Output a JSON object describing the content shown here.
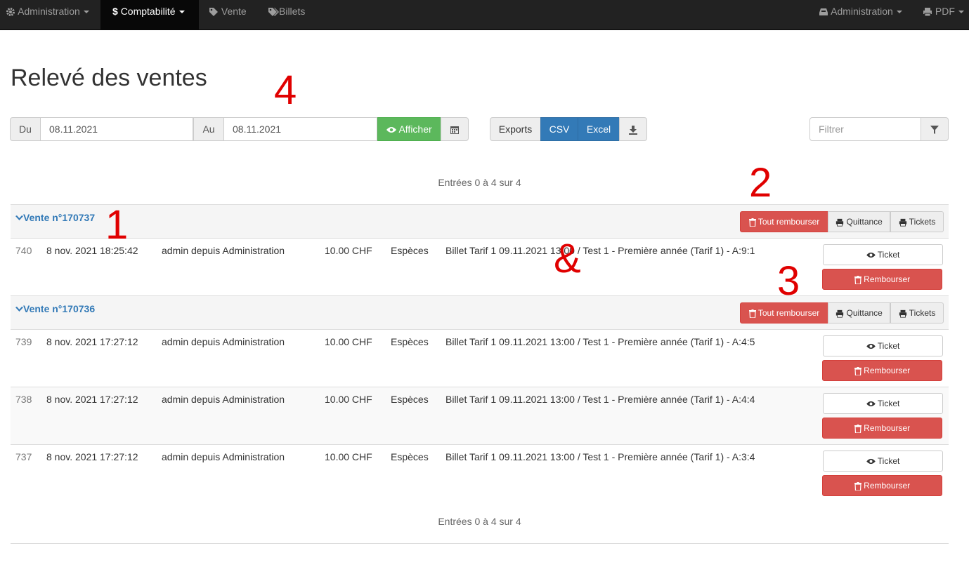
{
  "navbar": {
    "left": [
      {
        "label": "Administration",
        "icon": "gear-icon"
      },
      {
        "label": "Comptabilité",
        "icon": "dollar-icon",
        "active": true
      },
      {
        "label": "Vente",
        "icon": "tag-icon"
      },
      {
        "label": "Billets",
        "icon": "tags-icon"
      }
    ],
    "right": [
      {
        "label": "Administration",
        "icon": "inbox-icon"
      },
      {
        "label": "PDF",
        "icon": "print-icon"
      }
    ]
  },
  "page_title": "Relevé des ventes",
  "filters": {
    "from_label": "Du",
    "from_value": "08.11.2021",
    "to_label": "Au",
    "to_value": "08.11.2021",
    "show_label": "Afficher",
    "exports_label": "Exports",
    "csv_label": "CSV",
    "excel_label": "Excel",
    "filter_placeholder": "Filtrer"
  },
  "pagination_text": "Entrées 0 à 4 sur 4",
  "action_labels": {
    "refund_all": "Tout rembourser",
    "receipt": "Quittance",
    "tickets": "Tickets",
    "ticket": "Ticket",
    "refund": "Rembourser"
  },
  "sales": [
    {
      "title": "Vente n°170737",
      "rows": [
        {
          "id": "740",
          "date": "8 nov. 2021 18:25:42",
          "user": "admin depuis Administration",
          "amount": "10.00 CHF",
          "payment": "Espèces",
          "item": "Billet Tarif 1 09.11.2021 13:00 / Test 1 - Première année (Tarif 1) - A:9:1"
        }
      ]
    },
    {
      "title": "Vente n°170736",
      "rows": [
        {
          "id": "739",
          "date": "8 nov. 2021 17:27:12",
          "user": "admin depuis Administration",
          "amount": "10.00 CHF",
          "payment": "Espèces",
          "item": "Billet Tarif 1 09.11.2021 13:00 / Test 1 - Première année (Tarif 1) - A:4:5"
        },
        {
          "id": "738",
          "date": "8 nov. 2021 17:27:12",
          "user": "admin depuis Administration",
          "amount": "10.00 CHF",
          "payment": "Espèces",
          "item": "Billet Tarif 1 09.11.2021 13:00 / Test 1 - Première année (Tarif 1) - A:4:4"
        },
        {
          "id": "737",
          "date": "8 nov. 2021 17:27:12",
          "user": "admin depuis Administration",
          "amount": "10.00 CHF",
          "payment": "Espèces",
          "item": "Billet Tarif 1 09.11.2021 13:00 / Test 1 - Première année (Tarif 1) - A:3:4"
        }
      ]
    }
  ],
  "annotations": [
    "1",
    "2",
    "3",
    "4",
    "&"
  ],
  "colors": {
    "primary": "#337ab7",
    "success": "#5cb85c",
    "danger": "#d9534f",
    "annotation": "#e00000"
  }
}
